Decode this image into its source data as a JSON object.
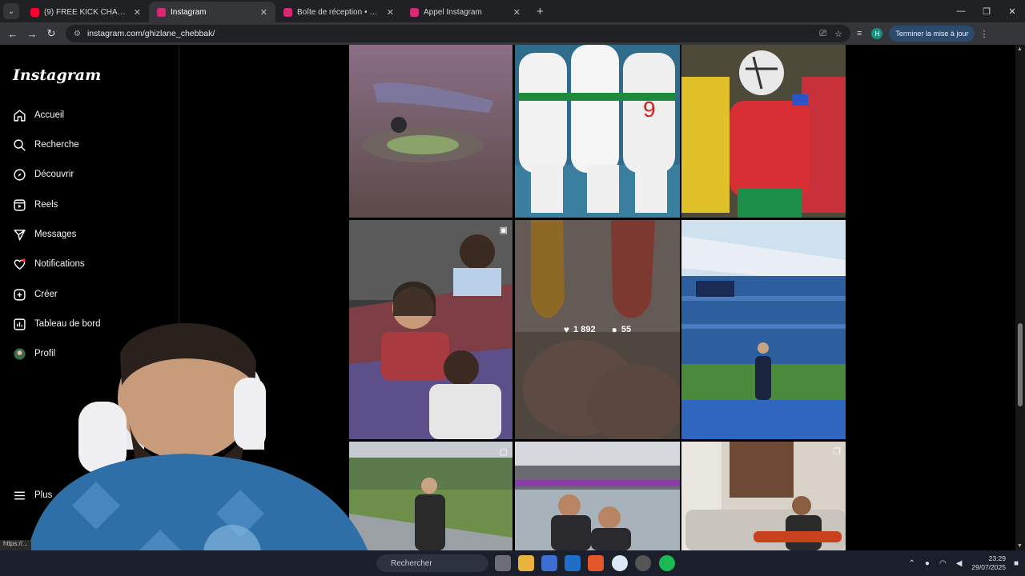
{
  "browser": {
    "tabs": [
      {
        "title": "(9) FREE KICK CHALLENGE 🔥 ...",
        "favicon_color": "#ff0033",
        "active": false
      },
      {
        "title": "Instagram",
        "favicon_color": "#d62976",
        "active": true
      },
      {
        "title": "Boîte de réception • Direct",
        "favicon_color": "#d62976",
        "active": false
      },
      {
        "title": "Appel Instagram",
        "favicon_color": "#d62976",
        "active": false
      }
    ],
    "url": "instagram.com/ghizlane_chebbak/",
    "update_button": "Terminer la mise à jour",
    "profile_initial": "H",
    "status_url": "https://..."
  },
  "sidebar": {
    "logo": "Instagram",
    "items": [
      {
        "label": "Accueil",
        "icon": "home-icon"
      },
      {
        "label": "Recherche",
        "icon": "search-icon"
      },
      {
        "label": "Découvrir",
        "icon": "compass-icon"
      },
      {
        "label": "Reels",
        "icon": "reels-icon"
      },
      {
        "label": "Messages",
        "icon": "send-icon"
      },
      {
        "label": "Notifications",
        "icon": "heart-icon"
      },
      {
        "label": "Créer",
        "icon": "plus-icon"
      },
      {
        "label": "Tableau de bord",
        "icon": "dashboard-icon"
      },
      {
        "label": "Profil",
        "icon": "avatar-icon"
      }
    ],
    "more_label": "Plus"
  },
  "grid": {
    "hover_post": {
      "likes": "1 892",
      "comments": "55"
    }
  },
  "taskbar": {
    "search_placeholder": "Rechercher",
    "time": "23:29",
    "date": "29/07/2025"
  },
  "colors": {
    "accent": "#0095f6",
    "notification_dot": "#ff3040"
  }
}
